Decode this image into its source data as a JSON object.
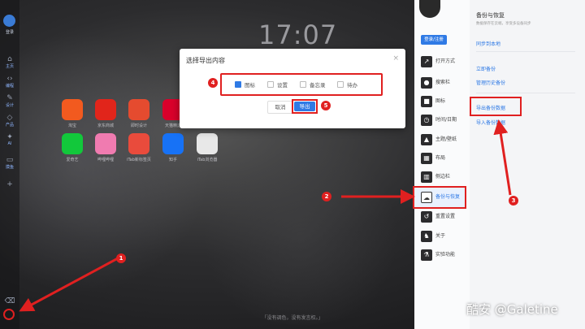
{
  "clock": "17:07",
  "rail": {
    "logo_label": "登录",
    "items": [
      {
        "label": "主页",
        "icon": "home-icon"
      },
      {
        "label": "编程",
        "icon": "code-icon"
      },
      {
        "label": "设计",
        "icon": "design-icon"
      },
      {
        "label": "产品",
        "icon": "product-icon"
      },
      {
        "label": "AI",
        "icon": "ai-icon"
      },
      {
        "label": "摸鱼",
        "icon": "fish-icon"
      }
    ]
  },
  "apps": [
    {
      "label": "淘宝",
      "color": "#f25a1f",
      "glyph": "淘"
    },
    {
      "label": "京东商城",
      "color": "#e1251b",
      "glyph": "J"
    },
    {
      "label": "即时设计",
      "color": "#e54b2f",
      "glyph": "◎"
    },
    {
      "label": "天猫精选",
      "color": "#d9002b",
      "glyph": "天猫"
    },
    {
      "label": "爱奇艺",
      "color": "#12c83b",
      "glyph": "iQIYI"
    },
    {
      "label": "哔哩哔哩",
      "color": "#f07bb0",
      "glyph": "bili"
    },
    {
      "label": "iTab新标签页",
      "color": "#e94b3c",
      "glyph": "iT"
    },
    {
      "label": "知乎",
      "color": "#1772f6",
      "glyph": "知"
    },
    {
      "label": "iTab浏览器",
      "color": "#e8e8e8",
      "glyph": "iT"
    }
  ],
  "quote": "「没有调色，没有发言权。」",
  "dialog": {
    "title": "选择导出内容",
    "close": "×",
    "options": [
      {
        "label": "图标",
        "checked": true
      },
      {
        "label": "设置",
        "checked": false
      },
      {
        "label": "备忘录",
        "checked": false
      },
      {
        "label": "待办",
        "checked": false
      }
    ],
    "cancel": "取消",
    "export": "导出"
  },
  "panel": {
    "login": "登录/注册",
    "menu": [
      {
        "label": "打开方式",
        "icon": "↗"
      },
      {
        "label": "搜索栏",
        "icon": "●"
      },
      {
        "label": "图标",
        "icon": "■"
      },
      {
        "label": "时间/日期",
        "icon": "◷"
      },
      {
        "label": "主题/壁纸",
        "icon": "▲"
      },
      {
        "label": "布局",
        "icon": "▦"
      },
      {
        "label": "侧边栏",
        "icon": "▥"
      },
      {
        "label": "备份与恢复",
        "icon": "☁"
      },
      {
        "label": "重置设置",
        "icon": "↺"
      },
      {
        "label": "关于",
        "icon": "♞"
      },
      {
        "label": "实验功能",
        "icon": "⚗"
      }
    ],
    "content": {
      "title": "备份与恢复",
      "subtitle": "数据保存在云端，享受多设备同步",
      "items": [
        "同步到本地",
        "立即备份",
        "管理历史备份",
        "导出备份数据",
        "导入备份数据"
      ]
    }
  },
  "watermark": "酷安 @Galetine",
  "markers": [
    "1",
    "2",
    "3",
    "4",
    "5"
  ]
}
